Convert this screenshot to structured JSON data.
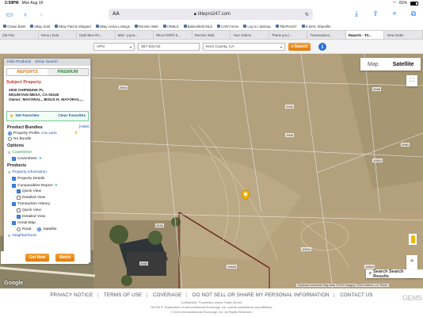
{
  "status": {
    "time": "2:59PM",
    "date": "Mon Aug 19",
    "battery": "81%"
  },
  "browser": {
    "url_prefix": "AA",
    "domain": "titlepro247.com",
    "bookmarks": [
      "Chase Bank",
      "eBay Sold",
      "eBay Paid & Shipped",
      "eBay Active Listings",
      "Remine Web",
      "CRMLS",
      "Bakersfield MLS",
      "CAR Forms",
      "Log in | dotloop",
      "TitlePro247",
      "K-MAC Sharefile"
    ],
    "tabs": [
      "(35 Far)",
      "Temu | Exal",
      "Dark Blue Re...",
      "Mail - joyca...",
      "REALTOR® S...",
      "Remine Web",
      "Your Orders",
      "Thank you |...",
      "Transactions...",
      "Reports - Tit...",
      "View Order"
    ],
    "active_tab": 9
  },
  "toolbar": {
    "search_type": "APN",
    "apn_value": "367-031-02",
    "county": "Kern County, CA",
    "search_label": "Search",
    "info_icon": "i"
  },
  "panel": {
    "hide_products": "Hide Products",
    "show_search": "Show Search",
    "tab_reports": "REPORTS",
    "tab_premium": "PREMIUM",
    "subject_heading": "Subject Property",
    "address_line1": "2930 CHIPMUNK PL",
    "address_line2": "MOUNTAIN MESA, CA 93240",
    "owner": "Owner: MAYORAL, JESUS H; MAYORAL,...",
    "set_favorites": "Set Favorites",
    "clear_favorites": "Clear Favorites",
    "product_bundles": "Product Bundles",
    "hide": "[Hide]",
    "property_profile": "Property Profile",
    "a_la_carte": "a la carte",
    "no_bundle": "No Bundle",
    "options": "Options",
    "coversheet_group": "Coversheet",
    "coversheet": "Coversheet",
    "products": "Products",
    "property_information": "Property Information",
    "property_details": "Property Details",
    "comparables_report": "Comparables Report",
    "quick_view": "Quick View",
    "detailed_view": "Detailed View",
    "transaction_history": "Transaction History",
    "quick_view2": "Quick View",
    "detailed_view2": "Detailed View",
    "aerial_map": "Aerial Map",
    "road": "Road",
    "satellite_opt": "Satellite",
    "neighborhood": "Neighborhood",
    "get_now": "Get Now",
    "batch": "Batch"
  },
  "map": {
    "type_map": "Map",
    "type_satellite": "Satellite",
    "search_results": "Search Search Results",
    "google": "Google",
    "attribution": "Keyboard shortcuts   Map data ©2024 Imagery ©2024 Airbus   1 m   Terms",
    "parcel_labels": [
      "2904",
      "2926",
      "2940",
      "2948",
      "2960",
      "10510",
      "10541",
      "10519",
      "10525",
      "2930",
      "2934"
    ]
  },
  "footer": {
    "links": [
      "PRIVACY NOTICE",
      "TERMS OF USE",
      "COVERAGE",
      "DO NOT SELL OR SHARE MY PERSONAL INFORMATION",
      "CONTACT US"
    ],
    "line1": "Confidential, Proprietary and/or Trade Secret.",
    "line2": "TM SM ® Trademarks of Intercontinental Exchange, Inc. and its subsidiaries and affiliates.",
    "line3": "© 2024 Intercontinental Exchange, Inc. All Rights Reserved.",
    "gems": "GEMS"
  }
}
